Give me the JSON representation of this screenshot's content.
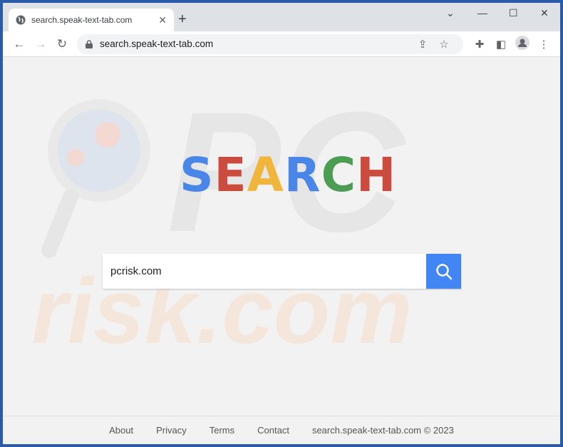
{
  "browser": {
    "tab_title": "search.speak-text-tab.com",
    "url": "search.speak-text-tab.com"
  },
  "logo": {
    "letters": [
      "S",
      "E",
      "A",
      "R",
      "C",
      "H"
    ],
    "colors": [
      "#4a86e8",
      "#cc4b3f",
      "#f0b63c",
      "#4a86e8",
      "#4d9c53",
      "#cc4b3f"
    ]
  },
  "search": {
    "value": "pcrisk.com"
  },
  "footer": {
    "links": [
      "About",
      "Privacy",
      "Terms",
      "Contact"
    ],
    "copyright": "search.speak-text-tab.com © 2023"
  },
  "colors": {
    "accent": "#4285f4"
  }
}
